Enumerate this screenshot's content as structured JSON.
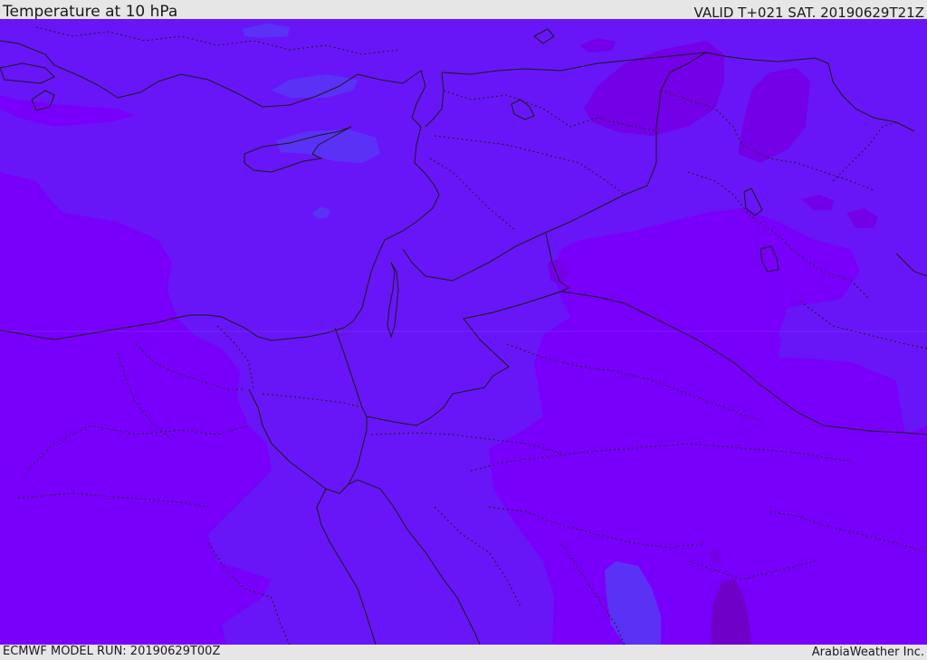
{
  "header": {
    "title": "Temperature at 10 hPa",
    "valid_time": "VALID T+021 SAT. 20190629T21Z"
  },
  "footer": {
    "model_run": "ECMWF MODEL RUN: 20190629T00Z",
    "credit": "ArabiaWeather Inc."
  },
  "colors": {
    "background_level": "#7800fa",
    "mid_level": "#6816f7",
    "light_level": "#5a32f5",
    "warm_level": "#7300e6",
    "warmest_level": "#6e00c8",
    "boundary_line": "#1a1a1a",
    "bar_background": "#e6e6e6"
  }
}
